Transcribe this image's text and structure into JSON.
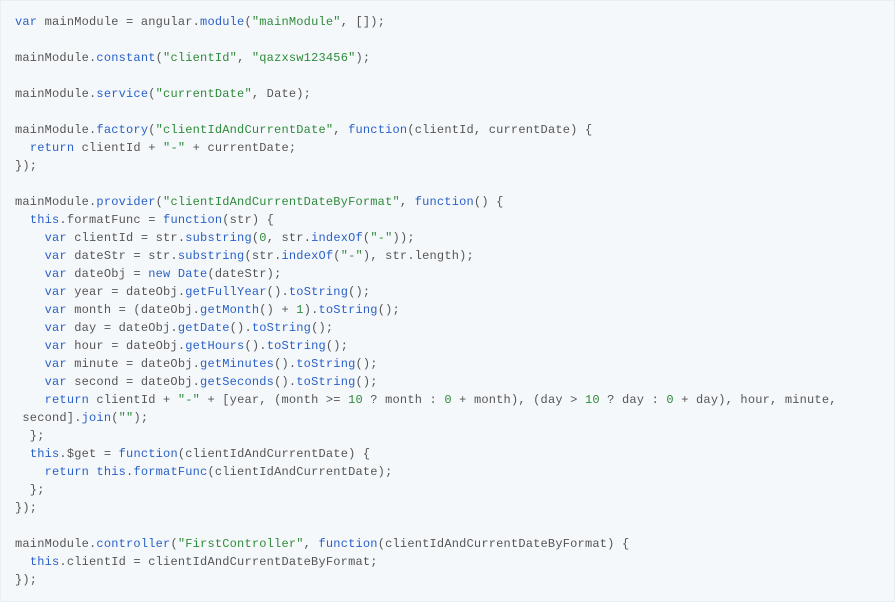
{
  "code": {
    "lines": [
      [
        {
          "t": "var ",
          "c": "k"
        },
        {
          "t": "mainModule = angular.",
          "c": "id"
        },
        {
          "t": "module",
          "c": "fn"
        },
        {
          "t": "(",
          "c": "p"
        },
        {
          "t": "\"mainModule\"",
          "c": "s"
        },
        {
          "t": ", []);",
          "c": "p"
        }
      ],
      [],
      [
        {
          "t": "mainModule.",
          "c": "id"
        },
        {
          "t": "constant",
          "c": "fn"
        },
        {
          "t": "(",
          "c": "p"
        },
        {
          "t": "\"clientId\"",
          "c": "s"
        },
        {
          "t": ", ",
          "c": "p"
        },
        {
          "t": "\"qazxsw123456\"",
          "c": "s"
        },
        {
          "t": ");",
          "c": "p"
        }
      ],
      [],
      [
        {
          "t": "mainModule.",
          "c": "id"
        },
        {
          "t": "service",
          "c": "fn"
        },
        {
          "t": "(",
          "c": "p"
        },
        {
          "t": "\"currentDate\"",
          "c": "s"
        },
        {
          "t": ", Date);",
          "c": "p"
        }
      ],
      [],
      [
        {
          "t": "mainModule.",
          "c": "id"
        },
        {
          "t": "factory",
          "c": "fn"
        },
        {
          "t": "(",
          "c": "p"
        },
        {
          "t": "\"clientIdAndCurrentDate\"",
          "c": "s"
        },
        {
          "t": ", ",
          "c": "p"
        },
        {
          "t": "function",
          "c": "k"
        },
        {
          "t": "(",
          "c": "p"
        },
        {
          "t": "clientId, currentDate",
          "c": "id"
        },
        {
          "t": ") {",
          "c": "p"
        }
      ],
      [
        {
          "t": "  ",
          "c": "p"
        },
        {
          "t": "return ",
          "c": "k"
        },
        {
          "t": "clientId + ",
          "c": "id"
        },
        {
          "t": "\"-\"",
          "c": "s"
        },
        {
          "t": " + currentDate;",
          "c": "id"
        }
      ],
      [
        {
          "t": "});",
          "c": "p"
        }
      ],
      [],
      [
        {
          "t": "mainModule.",
          "c": "id"
        },
        {
          "t": "provider",
          "c": "fn"
        },
        {
          "t": "(",
          "c": "p"
        },
        {
          "t": "\"clientIdAndCurrentDateByFormat\"",
          "c": "s"
        },
        {
          "t": ", ",
          "c": "p"
        },
        {
          "t": "function",
          "c": "k"
        },
        {
          "t": "() {",
          "c": "p"
        }
      ],
      [
        {
          "t": "  ",
          "c": "p"
        },
        {
          "t": "this",
          "c": "k"
        },
        {
          "t": ".formatFunc = ",
          "c": "id"
        },
        {
          "t": "function",
          "c": "k"
        },
        {
          "t": "(str) {",
          "c": "p"
        }
      ],
      [
        {
          "t": "    ",
          "c": "p"
        },
        {
          "t": "var ",
          "c": "k"
        },
        {
          "t": "clientId = str.",
          "c": "id"
        },
        {
          "t": "substring",
          "c": "fn"
        },
        {
          "t": "(",
          "c": "p"
        },
        {
          "t": "0",
          "c": "n"
        },
        {
          "t": ", str.",
          "c": "id"
        },
        {
          "t": "indexOf",
          "c": "fn"
        },
        {
          "t": "(",
          "c": "p"
        },
        {
          "t": "\"-\"",
          "c": "s"
        },
        {
          "t": "));",
          "c": "p"
        }
      ],
      [
        {
          "t": "    ",
          "c": "p"
        },
        {
          "t": "var ",
          "c": "k"
        },
        {
          "t": "dateStr = str.",
          "c": "id"
        },
        {
          "t": "substring",
          "c": "fn"
        },
        {
          "t": "(str.",
          "c": "id"
        },
        {
          "t": "indexOf",
          "c": "fn"
        },
        {
          "t": "(",
          "c": "p"
        },
        {
          "t": "\"-\"",
          "c": "s"
        },
        {
          "t": "), str.length);",
          "c": "p"
        }
      ],
      [
        {
          "t": "    ",
          "c": "p"
        },
        {
          "t": "var ",
          "c": "k"
        },
        {
          "t": "dateObj = ",
          "c": "id"
        },
        {
          "t": "new ",
          "c": "k"
        },
        {
          "t": "Date",
          "c": "fn"
        },
        {
          "t": "(dateStr);",
          "c": "p"
        }
      ],
      [
        {
          "t": "    ",
          "c": "p"
        },
        {
          "t": "var ",
          "c": "k"
        },
        {
          "t": "year = dateObj.",
          "c": "id"
        },
        {
          "t": "getFullYear",
          "c": "fn"
        },
        {
          "t": "().",
          "c": "p"
        },
        {
          "t": "toString",
          "c": "fn"
        },
        {
          "t": "();",
          "c": "p"
        }
      ],
      [
        {
          "t": "    ",
          "c": "p"
        },
        {
          "t": "var ",
          "c": "k"
        },
        {
          "t": "month = (dateObj.",
          "c": "id"
        },
        {
          "t": "getMonth",
          "c": "fn"
        },
        {
          "t": "() + ",
          "c": "p"
        },
        {
          "t": "1",
          "c": "n"
        },
        {
          "t": ").",
          "c": "p"
        },
        {
          "t": "toString",
          "c": "fn"
        },
        {
          "t": "();",
          "c": "p"
        }
      ],
      [
        {
          "t": "    ",
          "c": "p"
        },
        {
          "t": "var ",
          "c": "k"
        },
        {
          "t": "day = dateObj.",
          "c": "id"
        },
        {
          "t": "getDate",
          "c": "fn"
        },
        {
          "t": "().",
          "c": "p"
        },
        {
          "t": "toString",
          "c": "fn"
        },
        {
          "t": "();",
          "c": "p"
        }
      ],
      [
        {
          "t": "    ",
          "c": "p"
        },
        {
          "t": "var ",
          "c": "k"
        },
        {
          "t": "hour = dateObj.",
          "c": "id"
        },
        {
          "t": "getHours",
          "c": "fn"
        },
        {
          "t": "().",
          "c": "p"
        },
        {
          "t": "toString",
          "c": "fn"
        },
        {
          "t": "();",
          "c": "p"
        }
      ],
      [
        {
          "t": "    ",
          "c": "p"
        },
        {
          "t": "var ",
          "c": "k"
        },
        {
          "t": "minute = dateObj.",
          "c": "id"
        },
        {
          "t": "getMinutes",
          "c": "fn"
        },
        {
          "t": "().",
          "c": "p"
        },
        {
          "t": "toString",
          "c": "fn"
        },
        {
          "t": "();",
          "c": "p"
        }
      ],
      [
        {
          "t": "    ",
          "c": "p"
        },
        {
          "t": "var ",
          "c": "k"
        },
        {
          "t": "second = dateObj.",
          "c": "id"
        },
        {
          "t": "getSeconds",
          "c": "fn"
        },
        {
          "t": "().",
          "c": "p"
        },
        {
          "t": "toString",
          "c": "fn"
        },
        {
          "t": "();",
          "c": "p"
        }
      ],
      [
        {
          "t": "    ",
          "c": "p"
        },
        {
          "t": "return ",
          "c": "k"
        },
        {
          "t": "clientId + ",
          "c": "id"
        },
        {
          "t": "\"-\"",
          "c": "s"
        },
        {
          "t": " + [year, (month >= ",
          "c": "id"
        },
        {
          "t": "10",
          "c": "n"
        },
        {
          "t": " ? month : ",
          "c": "id"
        },
        {
          "t": "0",
          "c": "n"
        },
        {
          "t": " + month), (day > ",
          "c": "id"
        },
        {
          "t": "10",
          "c": "n"
        },
        {
          "t": " ? day : ",
          "c": "id"
        },
        {
          "t": "0",
          "c": "n"
        },
        {
          "t": " + day), hour, minute,",
          "c": "id"
        }
      ],
      [
        {
          "t": " second].",
          "c": "id"
        },
        {
          "t": "join",
          "c": "fn"
        },
        {
          "t": "(",
          "c": "p"
        },
        {
          "t": "\"\"",
          "c": "s"
        },
        {
          "t": ");",
          "c": "p"
        }
      ],
      [
        {
          "t": "  };",
          "c": "p"
        }
      ],
      [
        {
          "t": "  ",
          "c": "p"
        },
        {
          "t": "this",
          "c": "k"
        },
        {
          "t": ".$get = ",
          "c": "id"
        },
        {
          "t": "function",
          "c": "k"
        },
        {
          "t": "(",
          "c": "p"
        },
        {
          "t": "clientIdAndCurrentDate",
          "c": "id"
        },
        {
          "t": ") {",
          "c": "p"
        }
      ],
      [
        {
          "t": "    ",
          "c": "p"
        },
        {
          "t": "return ",
          "c": "k"
        },
        {
          "t": "this",
          "c": "k"
        },
        {
          "t": ".",
          "c": "id"
        },
        {
          "t": "formatFunc",
          "c": "fn"
        },
        {
          "t": "(clientIdAndCurrentDate);",
          "c": "p"
        }
      ],
      [
        {
          "t": "  };",
          "c": "p"
        }
      ],
      [
        {
          "t": "});",
          "c": "p"
        }
      ],
      [],
      [
        {
          "t": "mainModule.",
          "c": "id"
        },
        {
          "t": "controller",
          "c": "fn"
        },
        {
          "t": "(",
          "c": "p"
        },
        {
          "t": "\"FirstController\"",
          "c": "s"
        },
        {
          "t": ", ",
          "c": "p"
        },
        {
          "t": "function",
          "c": "k"
        },
        {
          "t": "(",
          "c": "p"
        },
        {
          "t": "clientIdAndCurrentDateByFormat",
          "c": "id"
        },
        {
          "t": ") {",
          "c": "p"
        }
      ],
      [
        {
          "t": "  ",
          "c": "p"
        },
        {
          "t": "this",
          "c": "k"
        },
        {
          "t": ".clientId = clientIdAndCurrentDateByFormat;",
          "c": "id"
        }
      ],
      [
        {
          "t": "});",
          "c": "p"
        }
      ]
    ]
  }
}
